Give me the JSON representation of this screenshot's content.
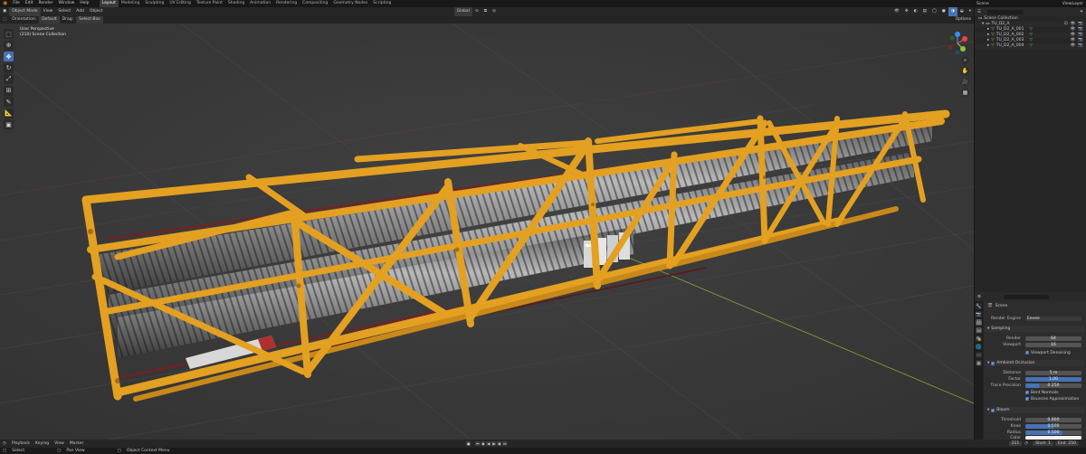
{
  "menubar": {
    "menus": [
      "File",
      "Edit",
      "Render",
      "Window",
      "Help"
    ],
    "workspaces": [
      "Layout",
      "Modeling",
      "Sculpting",
      "UV Editing",
      "Texture Paint",
      "Shading",
      "Animation",
      "Rendering",
      "Compositing",
      "Geometry Nodes",
      "Scripting"
    ],
    "active_workspace": "Layout",
    "scene": "Scene",
    "view_layer": "ViewLayer"
  },
  "viewport_header": {
    "mode": "Object Mode",
    "menus": [
      "View",
      "Select",
      "Add",
      "Object"
    ],
    "orientation_label": "Orientation:",
    "orientation": "Default",
    "drag_label": "Drag:",
    "drag": "Select Box",
    "transform": "Global",
    "options": "Options"
  },
  "viewport": {
    "view_name": "User Perspective",
    "collection": "(210) Scene Collection"
  },
  "toolbar": {
    "tools": [
      "select-box-icon",
      "cursor-icon",
      "move-icon",
      "rotate-icon",
      "scale-icon",
      "transform-icon",
      "annotate-icon",
      "measure-icon",
      "add-cube-icon"
    ]
  },
  "outliner": {
    "title": "Scene Collection",
    "rows": [
      {
        "name": "Scene Collection",
        "indent": 0,
        "type": "collection"
      },
      {
        "name": "TU_D2_A",
        "indent": 1,
        "type": "collection"
      },
      {
        "name": "TU_D2_A_001",
        "indent": 2,
        "type": "mesh"
      },
      {
        "name": "TU_D2_A_002",
        "indent": 2,
        "type": "mesh"
      },
      {
        "name": "TU_D2_A_003",
        "indent": 2,
        "type": "mesh"
      },
      {
        "name": "TU_D2_A_004",
        "indent": 2,
        "type": "mesh"
      }
    ]
  },
  "properties": {
    "context": "Scene",
    "render_engine_label": "Render Engine",
    "render_engine": "Eevee",
    "sampling": {
      "title": "Sampling",
      "render_label": "Render",
      "render": "64",
      "viewport_label": "Viewport",
      "viewport": "16",
      "denoise": "Viewport Denoising"
    },
    "ao": {
      "title": "Ambient Occlusion",
      "distance_label": "Distance",
      "distance": "5 m",
      "factor_label": "Factor",
      "factor": "1.00",
      "trace_label": "Trace Precision",
      "trace": "0.250",
      "bent_normals": "Bent Normals",
      "bounces": "Bounces Approximation"
    },
    "bloom": {
      "title": "Bloom",
      "threshold_label": "Threshold",
      "threshold": "0.800",
      "knee_label": "Knee",
      "knee": "0.500",
      "radius_label": "Radius",
      "radius": "6.500",
      "color_label": "Color"
    }
  },
  "timeline": {
    "menus": [
      "Playback",
      "Keying",
      "View",
      "Marker"
    ],
    "current_frame": "211",
    "start_label": "Start",
    "start": "1",
    "end_label": "End",
    "end": "250"
  },
  "statusbar": {
    "items": [
      "Select",
      "Pan View",
      "Object Context Menu"
    ]
  },
  "colors": {
    "accent": "#4772b3",
    "frame_orange": "#e3a021",
    "viewport_bg": "#3b3b3b",
    "pipe_gray": "#8a8a8a"
  }
}
